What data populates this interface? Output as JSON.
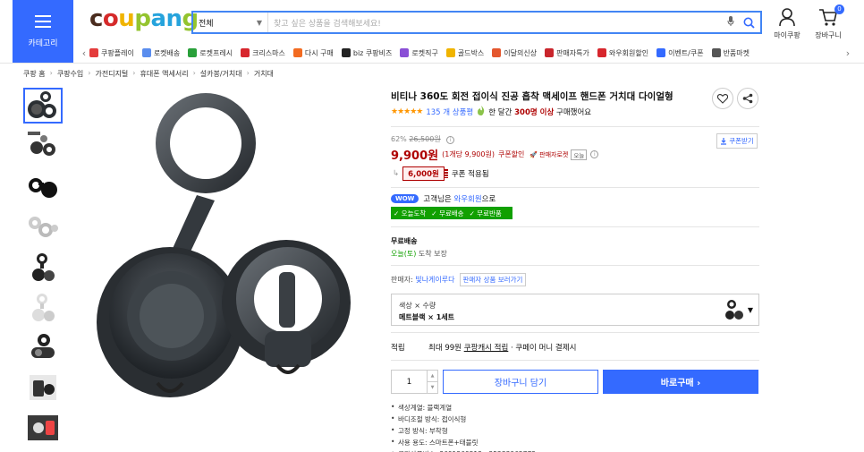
{
  "header": {
    "category_label": "카테고리",
    "logo_text": "coupang",
    "search": {
      "category": "전체",
      "placeholder": "찾고 싶은 상품을 검색해보세요!"
    },
    "my_label": "마이쿠팡",
    "cart_label": "장바구니",
    "cart_count": "0"
  },
  "shortcuts": [
    {
      "label": "쿠팡플레이",
      "color": "#e43c3c"
    },
    {
      "label": "로켓배송",
      "color": "#5a8dee"
    },
    {
      "label": "로켓프레시",
      "color": "#29a03a"
    },
    {
      "label": "크리스마스",
      "color": "#d7262d"
    },
    {
      "label": "다시 구매",
      "color": "#f26b21"
    },
    {
      "label": "biz 쿠팡비즈",
      "color": "#222222"
    },
    {
      "label": "로켓직구",
      "color": "#8a4fd6"
    },
    {
      "label": "골드박스",
      "color": "#f0b400"
    },
    {
      "label": "이달의신상",
      "color": "#e4572e"
    },
    {
      "label": "판매자특가",
      "color": "#c9252c"
    },
    {
      "label": "와우회원할인",
      "color": "#d7262d"
    },
    {
      "label": "이벤트/쿠폰",
      "color": "#346aff"
    },
    {
      "label": "반품마켓",
      "color": "#555555"
    }
  ],
  "breadcrumbs": [
    "쿠팡 홈",
    "쿠팡수입",
    "가전디지털",
    "휴대폰 액세서리",
    "설카봉/거치대",
    "거치대"
  ],
  "product": {
    "title": "비티나 360도 회전 접이식 진공 흡착 맥세이프 핸드폰 거치대 다이얼형",
    "stars": "★★★★★",
    "review_count": "135 개 상품평",
    "purchase_prefix": "한 달간",
    "purchase_count": "300명 이상",
    "purchase_suffix": "구매했어요",
    "discount_rate": "62%",
    "original_price": "26,500원",
    "price": "9,900원",
    "unit_price": "(1개당 9,900원)",
    "coupon_tag": "쿠폰할인",
    "seller_rocket": "판매자로켓",
    "seller_rocket_ok": "오늘",
    "coupon_download": "쿠폰받기",
    "coupon_amount": "6,000원",
    "coupon_applied": "쿠폰 적용됨",
    "wow_badge": "WOW",
    "member_text_1": "고객님은",
    "member_link": "와우회원",
    "member_text_2": "으로",
    "perks": [
      "✓ 오늘도착",
      "✓ 무료배송",
      "✓ 무료반품"
    ],
    "shipping_title": "무료배송",
    "shipping_day": "오늘(토)",
    "shipping_guarantee": "도착 보장",
    "seller_label": "판매자:",
    "seller_name": "빛나게이루다",
    "seller_more": "판매자 상품 보러가기",
    "option_line_1": "색상 × 수량",
    "option_line_2": "메트블랙 × 1세트",
    "reward_label": "적립",
    "reward_prefix": "최대 99원",
    "reward_link": "쿠팡캐시 적립",
    "reward_suffix": "· 쿠페이 머니 결제시",
    "quantity": "1",
    "cart_button": "장바구니 담기",
    "buy_button": "바로구매 ›",
    "specs": [
      "색상계열: 블랙계열",
      "바디조절 방식: 접이식형",
      "고정 방식: 부착형",
      "사용 용도: 스마트폰+태블릿",
      "쿠팡상품번호: 8691269512 - 25233962772"
    ]
  }
}
